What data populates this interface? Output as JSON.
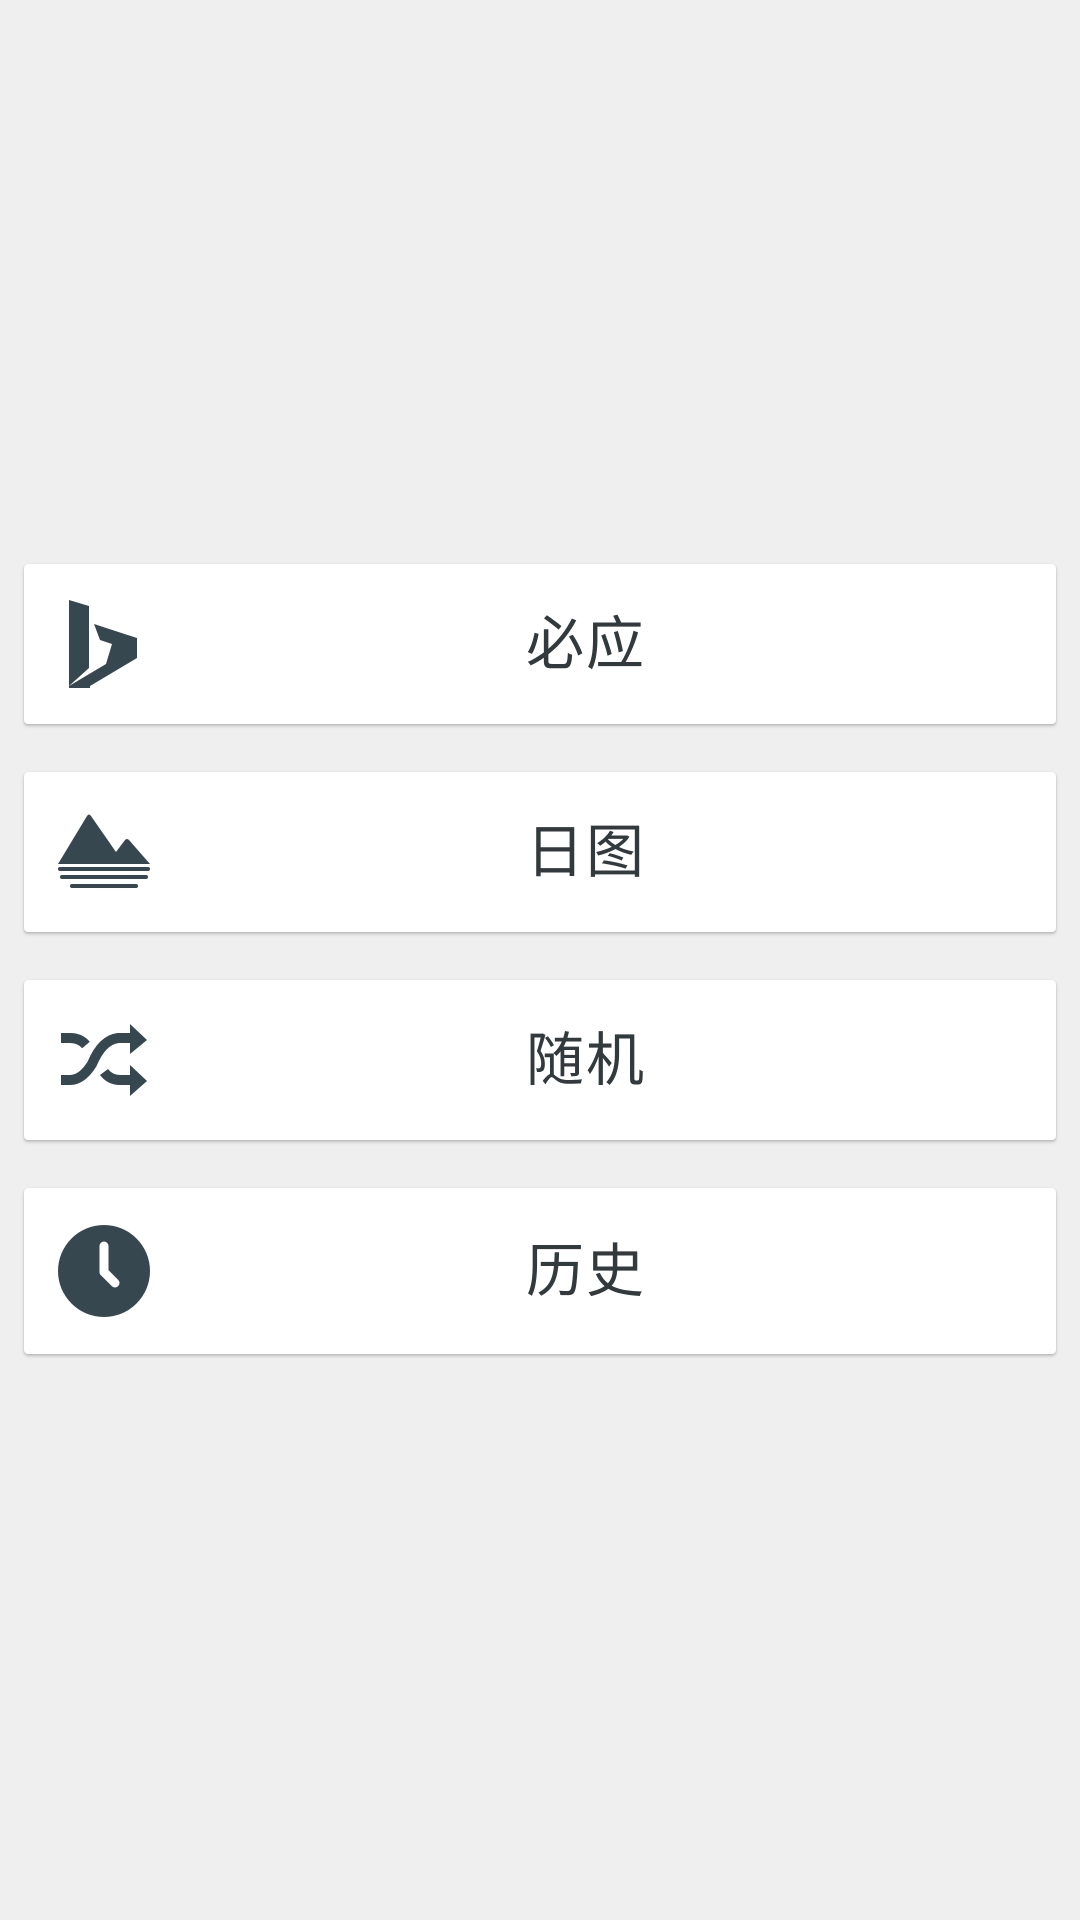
{
  "theme": {
    "background": "#efefef",
    "card_background": "#ffffff",
    "icon_color": "#37474f",
    "text_color": "#333a3d"
  },
  "menu": {
    "items": [
      {
        "label": "必应",
        "icon": "bing-logo-icon"
      },
      {
        "label": "日图",
        "icon": "landscape-icon"
      },
      {
        "label": "随机",
        "icon": "shuffle-icon"
      },
      {
        "label": "历史",
        "icon": "clock-icon"
      }
    ]
  }
}
